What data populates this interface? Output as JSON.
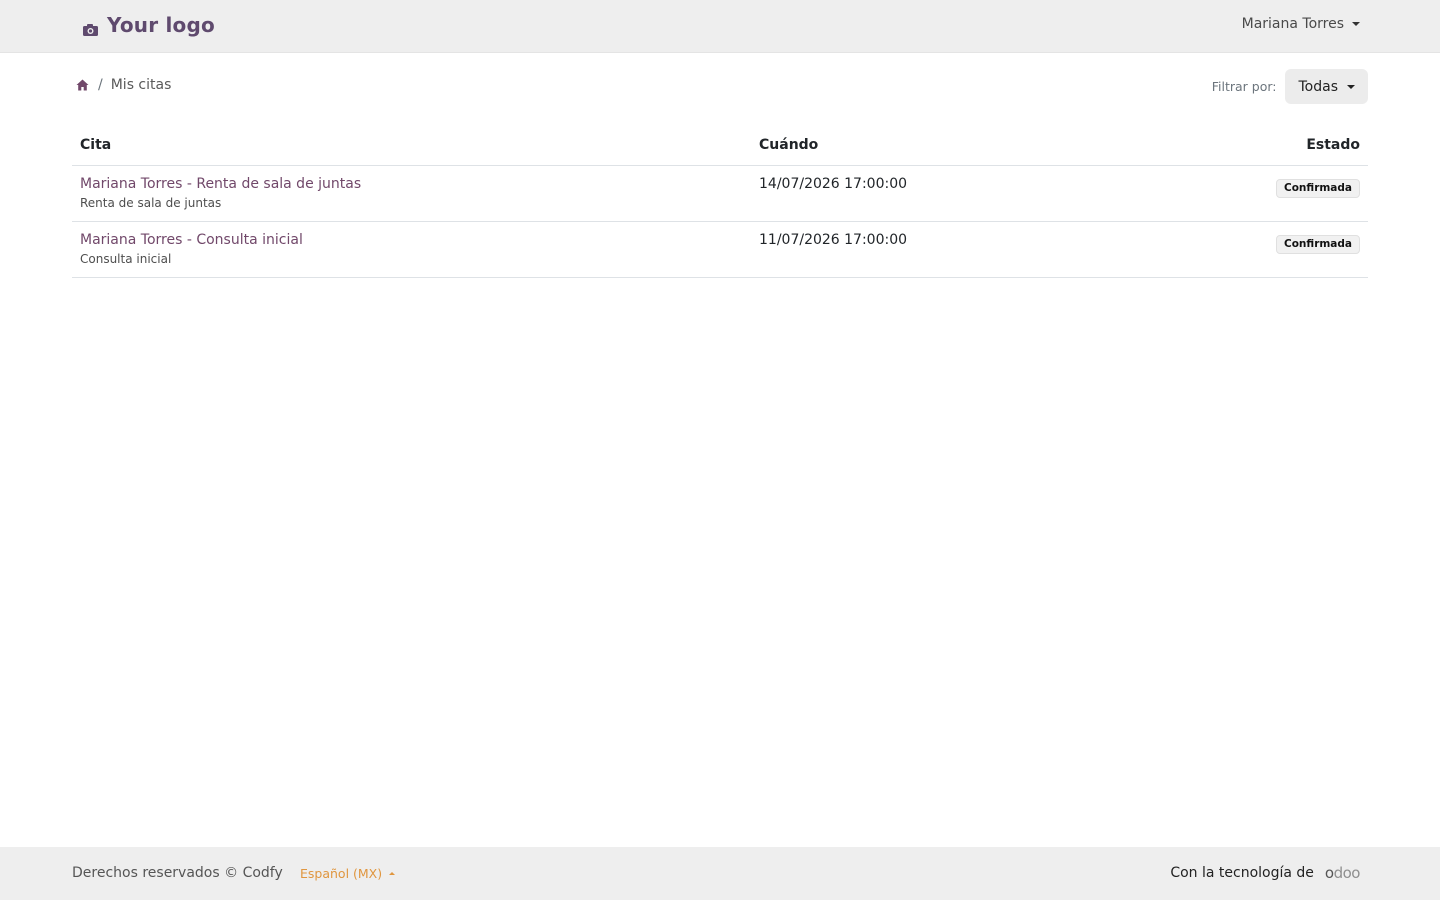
{
  "header": {
    "logo_text": "Your logo",
    "logo_icon": "camera-icon",
    "user_name": "Mariana Torres"
  },
  "breadcrumb": {
    "home_icon": "home-icon",
    "separator": "/",
    "current": "Mis citas"
  },
  "filter": {
    "label": "Filtrar por:",
    "selected": "Todas"
  },
  "table": {
    "headers": {
      "cita": "Cita",
      "cuando": "Cuándo",
      "estado": "Estado"
    },
    "rows": [
      {
        "title": "Mariana Torres - Renta de sala de juntas",
        "subtitle": "Renta de sala de juntas",
        "when": "14/07/2026 17:00:00",
        "status": "Confirmada"
      },
      {
        "title": "Mariana Torres - Consulta inicial",
        "subtitle": "Consulta inicial",
        "when": "11/07/2026 17:00:00",
        "status": "Confirmada"
      }
    ]
  },
  "footer": {
    "copyright": "Derechos reservados © Codfy",
    "language": "Español (MX)",
    "powered_by": "Con la tecnología de",
    "brand_first": "o",
    "brand_rest": "doo"
  },
  "colors": {
    "brand_purple": "#71486a",
    "logo_purple": "#5f4a6e",
    "language_orange": "#e0963f",
    "bar_gray": "#eeeeee"
  }
}
